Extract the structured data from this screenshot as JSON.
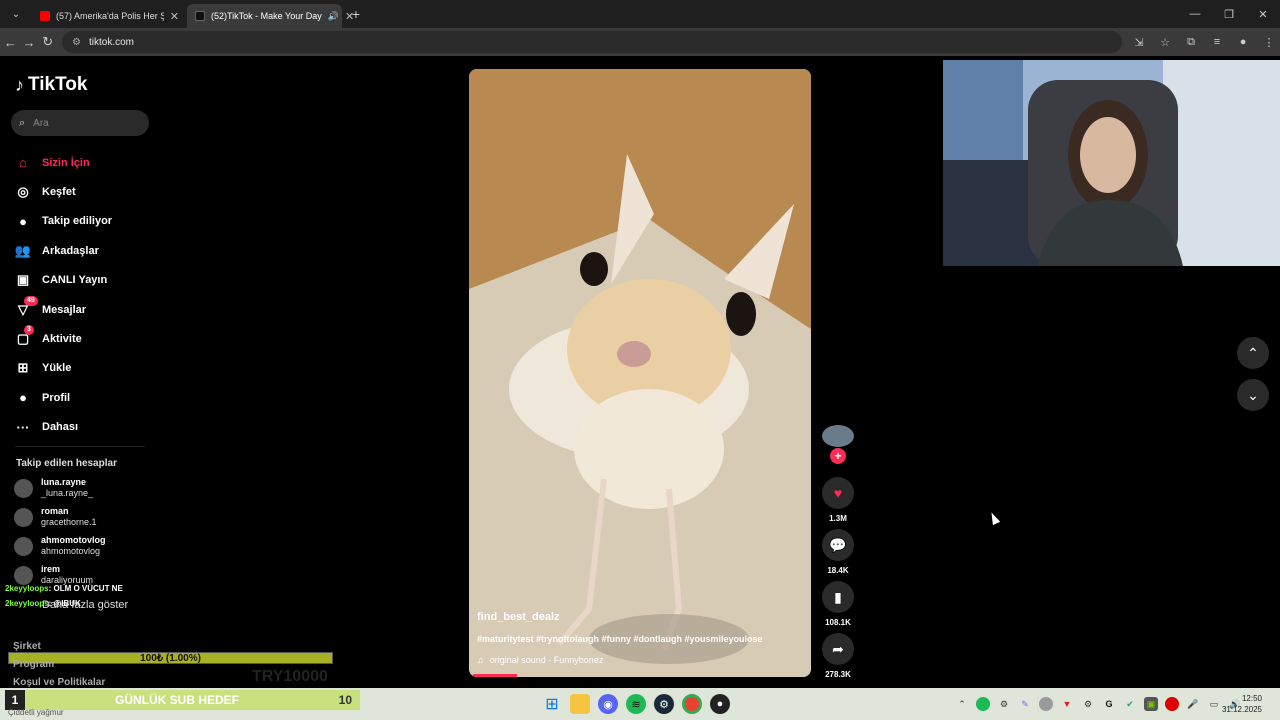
{
  "browser": {
    "tabs": [
      {
        "label": "(57) Amerika'da Polis Her Şeyi G",
        "favicon_color": "#ff0000",
        "active": false
      },
      {
        "label": "(52)TikTok - Make Your Day",
        "favicon_color": "#111111",
        "active": true
      }
    ],
    "url": "tiktok.com"
  },
  "sidebar": {
    "logo": "TikTok",
    "search_placeholder": "Ara",
    "nav": [
      {
        "label": "Sizin İçin",
        "icon": "home-icon",
        "glyph": "⌂",
        "active": true
      },
      {
        "label": "Keşfet",
        "icon": "compass-icon",
        "glyph": "◎"
      },
      {
        "label": "Takip ediliyor",
        "icon": "following-icon",
        "glyph": "●"
      },
      {
        "label": "Arkadaşlar",
        "icon": "friends-icon",
        "glyph": "👥"
      },
      {
        "label": "CANLI Yayın",
        "icon": "live-icon",
        "glyph": "▣"
      },
      {
        "label": "Mesajlar",
        "icon": "messages-icon",
        "glyph": "▽",
        "badge": "49"
      },
      {
        "label": "Aktivite",
        "icon": "activity-icon",
        "glyph": "▢",
        "badge": "3"
      },
      {
        "label": "Yükle",
        "icon": "upload-icon",
        "glyph": "⊞"
      },
      {
        "label": "Profil",
        "icon": "profile-icon",
        "glyph": "●"
      },
      {
        "label": "Dahası",
        "icon": "more-icon",
        "glyph": "···"
      }
    ],
    "followed_title": "Takip edilen hesaplar",
    "accounts": [
      {
        "name": "luna.rayne",
        "handle": "_luna.rayne_"
      },
      {
        "name": "roman",
        "handle": "gracethorne.1"
      },
      {
        "name": "ahmomotovlog",
        "handle": "ahmomotovlog"
      },
      {
        "name": "irem",
        "handle": "daraliyoruum"
      }
    ],
    "chat": [
      {
        "user": "2keyyloops",
        "msg": ": OLM O VÜCUT NE"
      },
      {
        "user": "2keyyloops",
        "msg": ": @IBUK"
      }
    ],
    "show_more": "Daha fazla göster",
    "footer": [
      "Şirket",
      "Program",
      "Koşul ve Politikalar"
    ],
    "goal_bar": "100₺ (1.00%)",
    "goal_overlay": "TRY10000"
  },
  "video": {
    "username": "find_best_dealz",
    "hashtags": "#maturitytest #trynottolaugh #funny #dontlaugh #yousmileyoulose",
    "sound": "original sound - Funnybonez",
    "progress": 0.13
  },
  "actions": {
    "likes": "1.3M",
    "comments": "18.4K",
    "saves": "108.1K",
    "shares": "278.3K"
  },
  "taskbar": {
    "goal_number": "1",
    "goal_label": "GÜNLÜK SUB HEDEF",
    "goal_value": "10",
    "goal_sub": "Çiddetli yağmur",
    "time": "12:50",
    "date": "31.12.2025"
  }
}
